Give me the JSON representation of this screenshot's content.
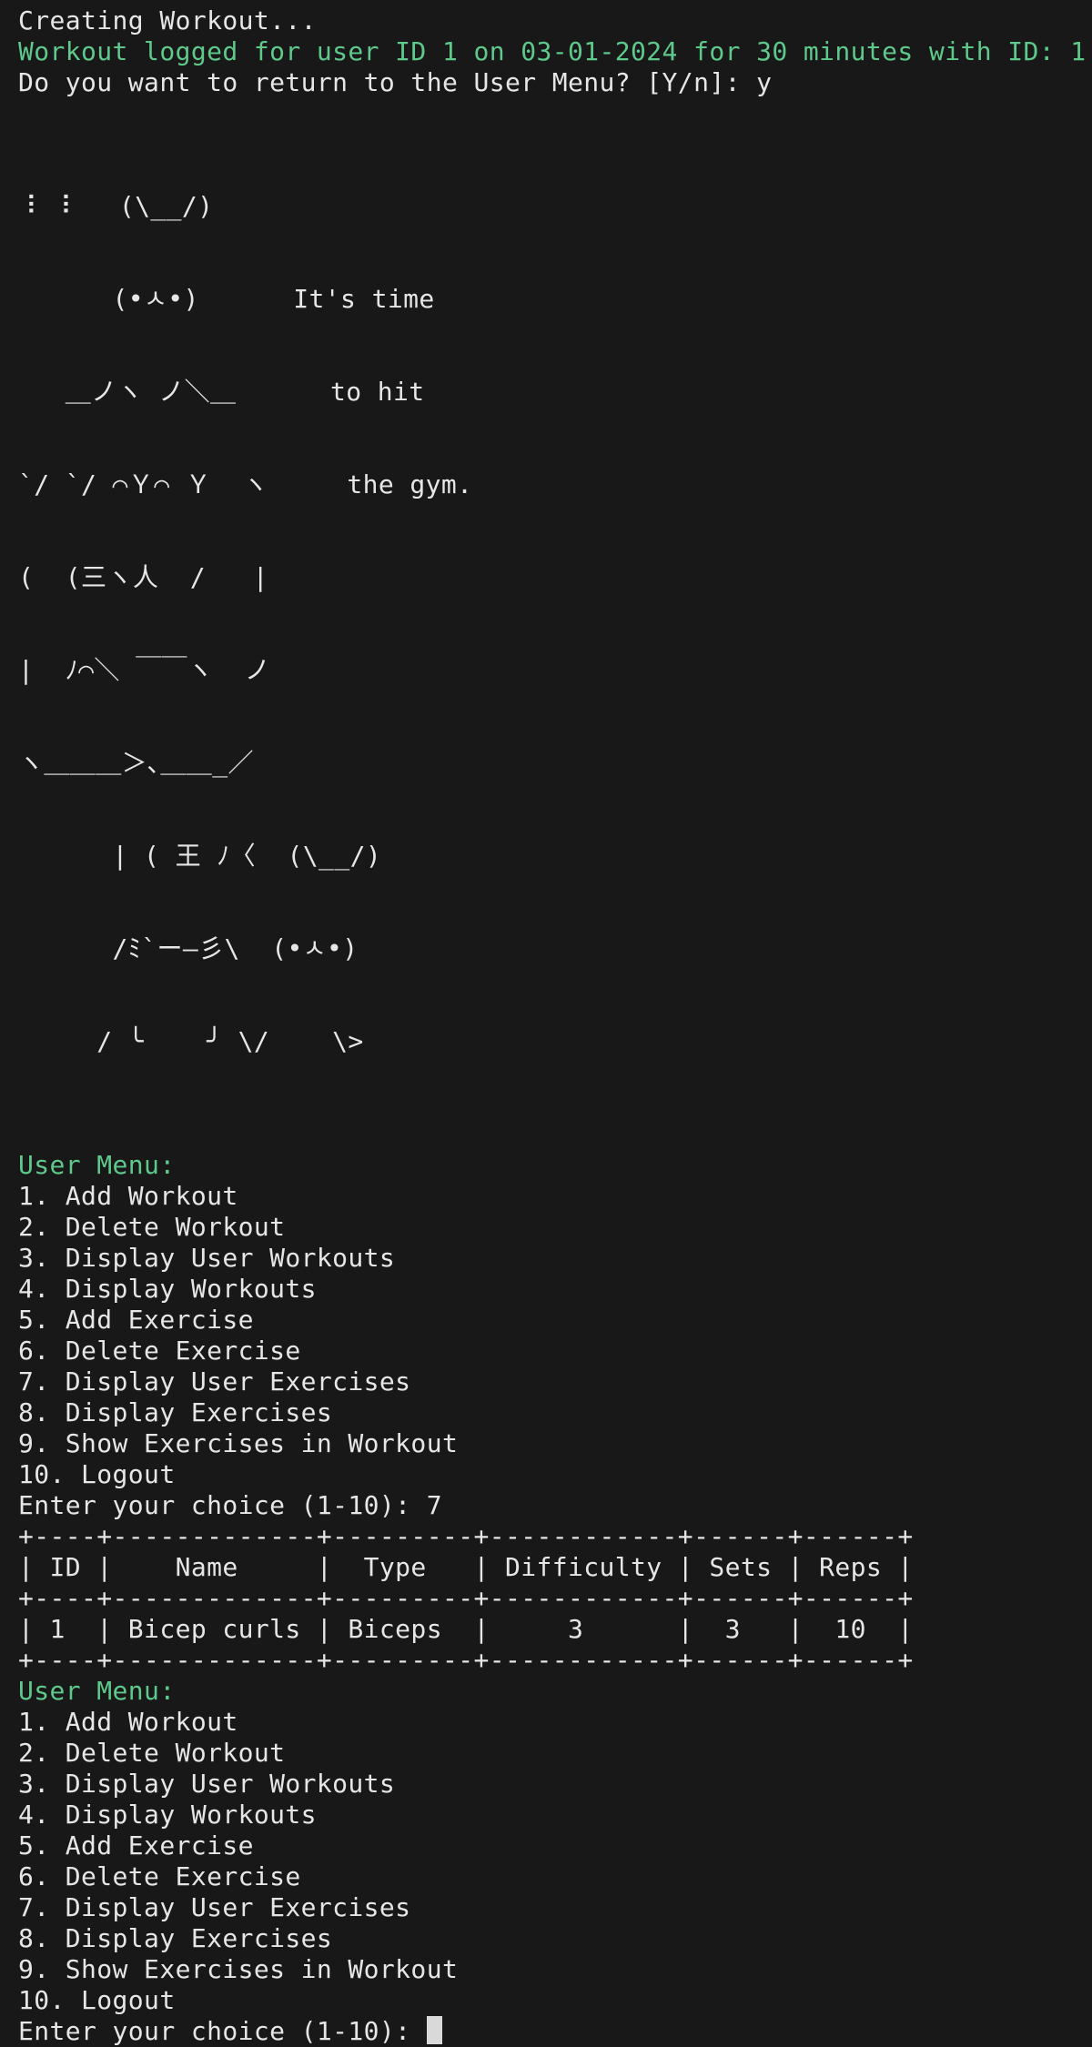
{
  "header": {
    "status_line": "Creating Workout...",
    "logged_message": "Workout logged for user ID 1 on 03-01-2024 for 30 minutes with ID: 1",
    "return_prompt": "Do you want to return to the User Menu? [Y/n]: y"
  },
  "ascii_art": {
    "lines": [
      "⠸ ⠸   (\\__/)",
      "      (•ㅅ•)      It's time",
      "   ＿ノヽ ノ＼＿      to hit",
      "`/ `/ ⌒Ｙ⌒ Ｙ  ヽ     the gym.",
      "(  (三ヽ人  /   |",
      "|  ﾉ⌒＼ ￣￣ヽ  ノ",
      "ヽ＿＿＿＞､＿＿_／",
      "      | ( 王 ﾉ〈  (\\__/)",
      "      /ﾐ`ー―彡\\  (•ㅅ•)",
      "     / ╰    ╯ \\/    \\>"
    ]
  },
  "menu_first": {
    "title": "User Menu:",
    "items": [
      "1. Add Workout",
      "2. Delete Workout",
      "3. Display User Workouts",
      "4. Display Workouts",
      "5. Add Exercise",
      "6. Delete Exercise",
      "7. Display User Exercises",
      "8. Display Exercises",
      "9. Show Exercises in Workout",
      "10. Logout"
    ],
    "prompt": "Enter your choice (1-10): 7"
  },
  "exercise_table": {
    "border": "+----+-------------+---------+------------+------+------+",
    "header": "| ID |    Name     |  Type   | Difficulty | Sets | Reps |",
    "rows": [
      "| 1  | Bicep curls | Biceps  |     3      |  3   |  10  |"
    ]
  },
  "menu_second": {
    "title": "User Menu:",
    "items": [
      "1. Add Workout",
      "2. Delete Workout",
      "3. Display User Workouts",
      "4. Display Workouts",
      "5. Add Exercise",
      "6. Delete Exercise",
      "7. Display User Exercises",
      "8. Display Exercises",
      "9. Show Exercises in Workout",
      "10. Logout"
    ],
    "prompt": "Enter your choice (1-10): "
  },
  "colors": {
    "background": "#181818",
    "text": "#e6e6e6",
    "accent_green": "#5fc98b",
    "cursor": "#d9d9d9"
  }
}
